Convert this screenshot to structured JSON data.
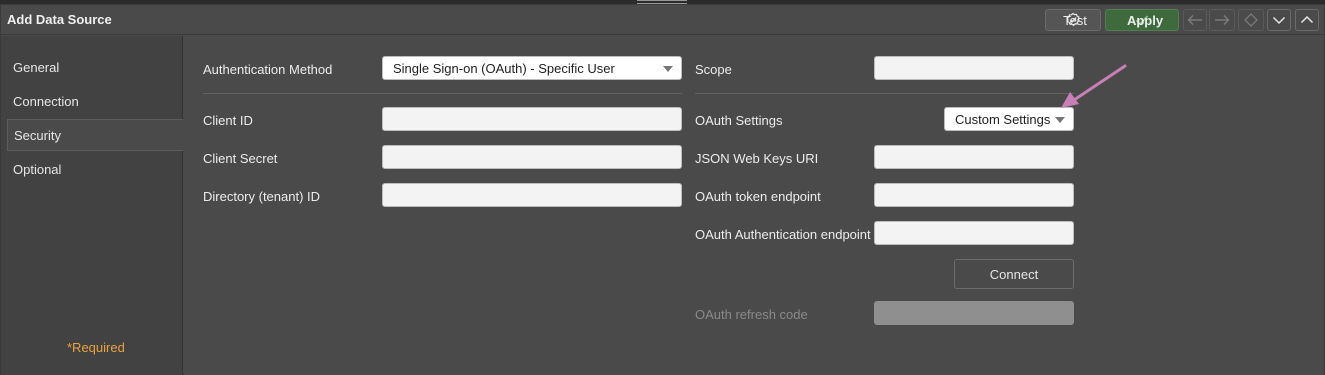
{
  "window": {
    "title": "Add Data Source"
  },
  "toolbar": {
    "test_label": "Test",
    "apply_label": "Apply",
    "icons": [
      "test-check-icon",
      "checkmark-icon",
      "arrow-left-icon",
      "arrow-right-icon",
      "diamond-icon",
      "chevron-down-icon",
      "chevron-up-icon"
    ]
  },
  "sidebar": {
    "items": [
      {
        "label": "General"
      },
      {
        "label": "Connection"
      },
      {
        "label": "Security",
        "active": true
      },
      {
        "label": "Optional"
      }
    ],
    "required_note": "*Required"
  },
  "form": {
    "auth_method": {
      "label": "Authentication Method",
      "value": "Single Sign-on (OAuth) - Specific User"
    },
    "scope": {
      "label": "Scope",
      "value": ""
    },
    "client_id": {
      "label": "Client ID",
      "value": ""
    },
    "client_secret": {
      "label": "Client Secret",
      "value": ""
    },
    "tenant_id": {
      "label": "Directory (tenant) ID",
      "value": ""
    },
    "oauth_settings": {
      "label": "OAuth Settings",
      "value": "Custom Settings"
    },
    "jwks_uri": {
      "label": "JSON Web Keys URI",
      "value": ""
    },
    "token_endpoint": {
      "label": "OAuth token endpoint",
      "value": ""
    },
    "auth_endpoint": {
      "label": "OAuth Authentication endpoint",
      "value": ""
    },
    "connect_label": "Connect",
    "refresh_code": {
      "label": "OAuth refresh code",
      "value": ""
    }
  },
  "colors": {
    "required": "#e8a33a",
    "apply_bg": "#3e6a3e",
    "annotation_arrow": "#c77fb5"
  }
}
